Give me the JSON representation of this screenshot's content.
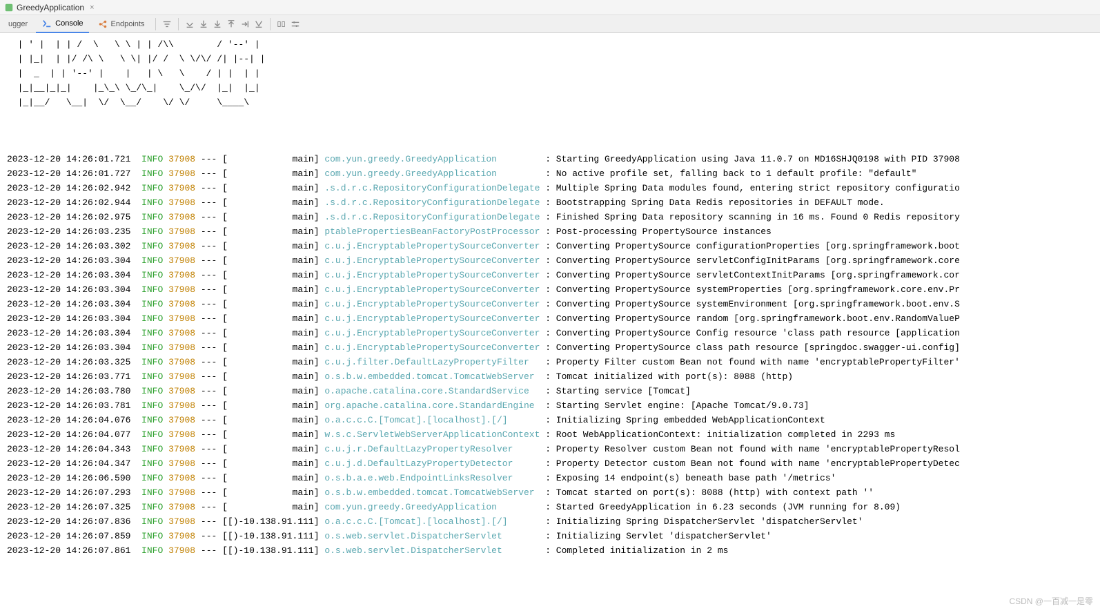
{
  "window": {
    "title": "GreedyApplication"
  },
  "tabs": {
    "debugger": "ugger",
    "console": "Console",
    "endpoints": "Endpoints"
  },
  "ascii_art": "  | ' |  | | /  \\   \\ \\ | | /\\\\        / '--' |\n  | |_|  | |/ /\\ \\   \\ \\| |/ /  \\ \\/\\/ /| |--| |\n  |  _  | | '--' |    |   | \\   \\    / | |  | |\n  |_|__|_|_|    |_\\_\\ \\_/\\_|    \\_/\\/  |_|  |_|\n  |_|__/   \\__|  \\/  \\__/    \\/ \\/     \\____\\",
  "logs": [
    {
      "ts": "2023-12-20 14:26:01.721",
      "level": "INFO",
      "pid": "37908",
      "thread": "main",
      "logger": "com.yun.greedy.GreedyApplication",
      "msg": "Starting GreedyApplication using Java 11.0.7 on MD16SHJQ0198 with PID 37908"
    },
    {
      "ts": "2023-12-20 14:26:01.727",
      "level": "INFO",
      "pid": "37908",
      "thread": "main",
      "logger": "com.yun.greedy.GreedyApplication",
      "msg": "No active profile set, falling back to 1 default profile: \"default\""
    },
    {
      "ts": "2023-12-20 14:26:02.942",
      "level": "INFO",
      "pid": "37908",
      "thread": "main",
      "logger": ".s.d.r.c.RepositoryConfigurationDelegate",
      "msg": "Multiple Spring Data modules found, entering strict repository configuratio"
    },
    {
      "ts": "2023-12-20 14:26:02.944",
      "level": "INFO",
      "pid": "37908",
      "thread": "main",
      "logger": ".s.d.r.c.RepositoryConfigurationDelegate",
      "msg": "Bootstrapping Spring Data Redis repositories in DEFAULT mode."
    },
    {
      "ts": "2023-12-20 14:26:02.975",
      "level": "INFO",
      "pid": "37908",
      "thread": "main",
      "logger": ".s.d.r.c.RepositoryConfigurationDelegate",
      "msg": "Finished Spring Data repository scanning in 16 ms. Found 0 Redis repository"
    },
    {
      "ts": "2023-12-20 14:26:03.235",
      "level": "INFO",
      "pid": "37908",
      "thread": "main",
      "logger": "ptablePropertiesBeanFactoryPostProcessor",
      "msg": "Post-processing PropertySource instances"
    },
    {
      "ts": "2023-12-20 14:26:03.302",
      "level": "INFO",
      "pid": "37908",
      "thread": "main",
      "logger": "c.u.j.EncryptablePropertySourceConverter",
      "msg": "Converting PropertySource configurationProperties [org.springframework.boot"
    },
    {
      "ts": "2023-12-20 14:26:03.304",
      "level": "INFO",
      "pid": "37908",
      "thread": "main",
      "logger": "c.u.j.EncryptablePropertySourceConverter",
      "msg": "Converting PropertySource servletConfigInitParams [org.springframework.core"
    },
    {
      "ts": "2023-12-20 14:26:03.304",
      "level": "INFO",
      "pid": "37908",
      "thread": "main",
      "logger": "c.u.j.EncryptablePropertySourceConverter",
      "msg": "Converting PropertySource servletContextInitParams [org.springframework.cor"
    },
    {
      "ts": "2023-12-20 14:26:03.304",
      "level": "INFO",
      "pid": "37908",
      "thread": "main",
      "logger": "c.u.j.EncryptablePropertySourceConverter",
      "msg": "Converting PropertySource systemProperties [org.springframework.core.env.Pr"
    },
    {
      "ts": "2023-12-20 14:26:03.304",
      "level": "INFO",
      "pid": "37908",
      "thread": "main",
      "logger": "c.u.j.EncryptablePropertySourceConverter",
      "msg": "Converting PropertySource systemEnvironment [org.springframework.boot.env.S"
    },
    {
      "ts": "2023-12-20 14:26:03.304",
      "level": "INFO",
      "pid": "37908",
      "thread": "main",
      "logger": "c.u.j.EncryptablePropertySourceConverter",
      "msg": "Converting PropertySource random [org.springframework.boot.env.RandomValueP"
    },
    {
      "ts": "2023-12-20 14:26:03.304",
      "level": "INFO",
      "pid": "37908",
      "thread": "main",
      "logger": "c.u.j.EncryptablePropertySourceConverter",
      "msg": "Converting PropertySource Config resource 'class path resource [application"
    },
    {
      "ts": "2023-12-20 14:26:03.304",
      "level": "INFO",
      "pid": "37908",
      "thread": "main",
      "logger": "c.u.j.EncryptablePropertySourceConverter",
      "msg": "Converting PropertySource class path resource [springdoc.swagger-ui.config]"
    },
    {
      "ts": "2023-12-20 14:26:03.325",
      "level": "INFO",
      "pid": "37908",
      "thread": "main",
      "logger": "c.u.j.filter.DefaultLazyPropertyFilter",
      "msg": "Property Filter custom Bean not found with name 'encryptablePropertyFilter'"
    },
    {
      "ts": "2023-12-20 14:26:03.771",
      "level": "INFO",
      "pid": "37908",
      "thread": "main",
      "logger": "o.s.b.w.embedded.tomcat.TomcatWebServer",
      "msg": "Tomcat initialized with port(s): 8088 (http)"
    },
    {
      "ts": "2023-12-20 14:26:03.780",
      "level": "INFO",
      "pid": "37908",
      "thread": "main",
      "logger": "o.apache.catalina.core.StandardService",
      "msg": "Starting service [Tomcat]"
    },
    {
      "ts": "2023-12-20 14:26:03.781",
      "level": "INFO",
      "pid": "37908",
      "thread": "main",
      "logger": "org.apache.catalina.core.StandardEngine",
      "msg": "Starting Servlet engine: [Apache Tomcat/9.0.73]"
    },
    {
      "ts": "2023-12-20 14:26:04.076",
      "level": "INFO",
      "pid": "37908",
      "thread": "main",
      "logger": "o.a.c.c.C.[Tomcat].[localhost].[/]",
      "msg": "Initializing Spring embedded WebApplicationContext"
    },
    {
      "ts": "2023-12-20 14:26:04.077",
      "level": "INFO",
      "pid": "37908",
      "thread": "main",
      "logger": "w.s.c.ServletWebServerApplicationContext",
      "msg": "Root WebApplicationContext: initialization completed in 2293 ms"
    },
    {
      "ts": "2023-12-20 14:26:04.343",
      "level": "INFO",
      "pid": "37908",
      "thread": "main",
      "logger": "c.u.j.r.DefaultLazyPropertyResolver",
      "msg": "Property Resolver custom Bean not found with name 'encryptablePropertyResol"
    },
    {
      "ts": "2023-12-20 14:26:04.347",
      "level": "INFO",
      "pid": "37908",
      "thread": "main",
      "logger": "c.u.j.d.DefaultLazyPropertyDetector",
      "msg": "Property Detector custom Bean not found with name 'encryptablePropertyDetec"
    },
    {
      "ts": "2023-12-20 14:26:06.590",
      "level": "INFO",
      "pid": "37908",
      "thread": "main",
      "logger": "o.s.b.a.e.web.EndpointLinksResolver",
      "msg": "Exposing 14 endpoint(s) beneath base path '/metrics'"
    },
    {
      "ts": "2023-12-20 14:26:07.293",
      "level": "INFO",
      "pid": "37908",
      "thread": "main",
      "logger": "o.s.b.w.embedded.tomcat.TomcatWebServer",
      "msg": "Tomcat started on port(s): 8088 (http) with context path ''"
    },
    {
      "ts": "2023-12-20 14:26:07.325",
      "level": "INFO",
      "pid": "37908",
      "thread": "main",
      "logger": "com.yun.greedy.GreedyApplication",
      "msg": "Started GreedyApplication in 6.23 seconds (JVM running for 8.09)"
    },
    {
      "ts": "2023-12-20 14:26:07.836",
      "level": "INFO",
      "pid": "37908",
      "thread": "[)-10.138.91.111",
      "logger": "o.a.c.c.C.[Tomcat].[localhost].[/]",
      "msg": "Initializing Spring DispatcherServlet 'dispatcherServlet'"
    },
    {
      "ts": "2023-12-20 14:26:07.859",
      "level": "INFO",
      "pid": "37908",
      "thread": "[)-10.138.91.111",
      "logger": "o.s.web.servlet.DispatcherServlet",
      "msg": "Initializing Servlet 'dispatcherServlet'"
    },
    {
      "ts": "2023-12-20 14:26:07.861",
      "level": "INFO",
      "pid": "37908",
      "thread": "[)-10.138.91.111",
      "logger": "o.s.web.servlet.DispatcherServlet",
      "msg": "Completed initialization in 2 ms"
    }
  ],
  "watermark": "CSDN @一百减一是零"
}
